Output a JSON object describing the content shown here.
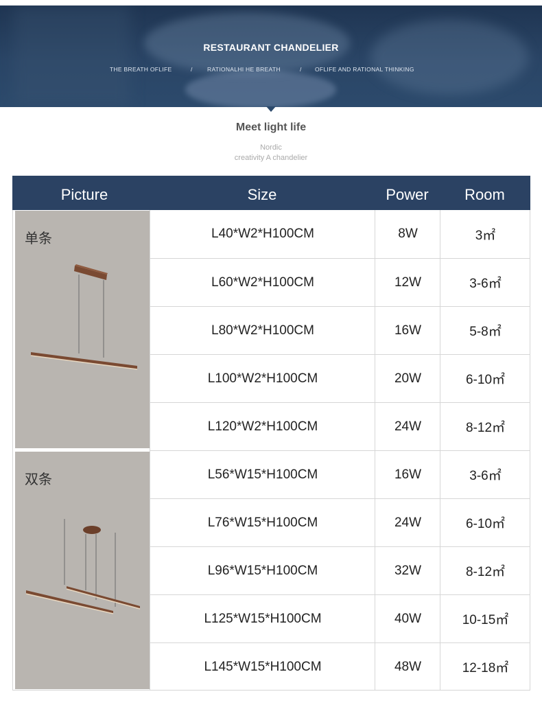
{
  "banner": {
    "title": "RESTAURANT CHANDELIER",
    "sub1": "THE BREATH OFLIFE",
    "sub2": "RATIONALHI HE BREATH",
    "sub3": "OFLIFE AND RATIONAL THINKING",
    "separator": "/"
  },
  "section": {
    "title": "Meet light life",
    "sub1": "Nordic",
    "sub2": "creativity A chandelier"
  },
  "table": {
    "headers": {
      "picture": "Picture",
      "size": "Size",
      "power": "Power",
      "room": "Room"
    },
    "groups": [
      {
        "label": "单条",
        "type": "single-bar-pendant"
      },
      {
        "label": "双条",
        "type": "double-bar-pendant"
      }
    ],
    "rows": [
      {
        "size": "L40*W2*H100CM",
        "power": "8W",
        "room": "3㎡"
      },
      {
        "size": "L60*W2*H100CM",
        "power": "12W",
        "room": "3-6㎡"
      },
      {
        "size": "L80*W2*H100CM",
        "power": "16W",
        "room": "5-8㎡"
      },
      {
        "size": "L100*W2*H100CM",
        "power": "20W",
        "room": "6-10㎡"
      },
      {
        "size": "L120*W2*H100CM",
        "power": "24W",
        "room": "8-12㎡"
      },
      {
        "size": "L56*W15*H100CM",
        "power": "16W",
        "room": "3-6㎡"
      },
      {
        "size": "L76*W15*H100CM",
        "power": "24W",
        "room": "6-10㎡"
      },
      {
        "size": "L96*W15*H100CM",
        "power": "32W",
        "room": "8-12㎡"
      },
      {
        "size": "L125*W15*H100CM",
        "power": "40W",
        "room": "10-15㎡"
      },
      {
        "size": "L145*W15*H100CM",
        "power": "48W",
        "room": "12-18㎡"
      }
    ]
  },
  "colors": {
    "header_bg": "#2b4263",
    "picture_bg": "#b9b5b0",
    "lamp_wood": "#7a4a32"
  }
}
